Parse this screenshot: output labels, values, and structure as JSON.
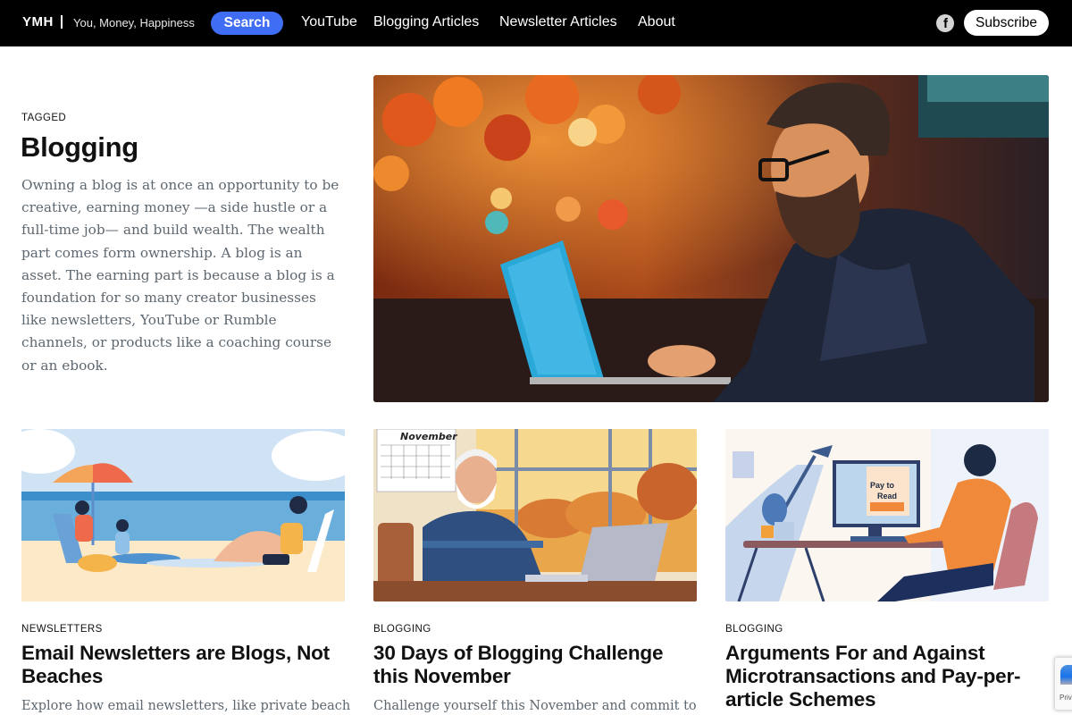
{
  "nav": {
    "logo": "YMH",
    "tagline": "You, Money, Happiness",
    "search_label": "Search",
    "links": [
      "YouTube",
      "Blogging Articles",
      "Newsletter Articles",
      "About"
    ],
    "social_icon": "facebook-icon",
    "subscribe_label": "Subscribe"
  },
  "colors": {
    "nav_bg": "#000000",
    "accent": "#3f6ef5",
    "body_text": "#5d6770"
  },
  "hero": {
    "tagged_label": "TAGGED",
    "title": "Blogging",
    "description": "Owning a blog is at once an opportunity to be creative, earning money —a side hustle or a full-time job— and build wealth. The wealth part comes form ownership. A blog is an asset. The earning part is because a blog is a foundation for so many creator businesses like newsletters, YouTube or Rumble channels, or products like a coaching course or an ebook.",
    "image_alt": "Bearded man with glasses typing on a blue laptop in an autumn-lit cafe"
  },
  "posts": [
    {
      "category": "NEWSLETTERS",
      "title": "Email Newsletters are Blogs, Not Beaches",
      "excerpt": "Explore how email newsletters, like private beach",
      "image_alt": "Family relaxing on a beach"
    },
    {
      "category": "BLOGGING",
      "title": "30 Days of Blogging Challenge this November",
      "excerpt": "Challenge yourself this November and commit to",
      "image_alt": "Older man with white beard at laptop, November calendar on wall",
      "calendar_label": "November"
    },
    {
      "category": "BLOGGING",
      "title": "Arguments For and Against Microtransactions and Pay-per-article Schemes",
      "excerpt": "",
      "image_alt": "Man at desk viewing a Pay to Read screen",
      "screen_text_1": "Pay to",
      "screen_text_2": "Read"
    }
  ],
  "recaptcha": {
    "label": "Privacy"
  }
}
